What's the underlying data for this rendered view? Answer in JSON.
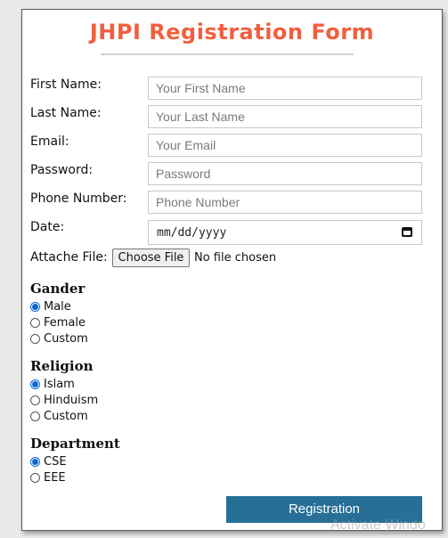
{
  "form": {
    "title": "JHPI Registration Form",
    "accent_color": "#f15f3f",
    "fields": {
      "first_name": {
        "label": "First Name:",
        "placeholder": "Your First Name"
      },
      "last_name": {
        "label": "Last Name:",
        "placeholder": "Your Last Name"
      },
      "email": {
        "label": "Email:",
        "placeholder": "Your Email"
      },
      "password": {
        "label": "Password:",
        "placeholder": "Password"
      },
      "phone": {
        "label": "Phone Number:",
        "placeholder": "Phone Number"
      },
      "date": {
        "label": "Date:",
        "value": "mm/dd/yyyy",
        "icon": "calendar-icon"
      },
      "file": {
        "label": "Attache File:",
        "button_label": "Choose File",
        "status": "No file chosen"
      }
    },
    "gender": {
      "heading": "Gander",
      "options": [
        {
          "label": "Male",
          "checked": true
        },
        {
          "label": "Female",
          "checked": false
        },
        {
          "label": "Custom",
          "checked": false
        }
      ]
    },
    "religion": {
      "heading": "Religion",
      "options": [
        {
          "label": "Islam",
          "checked": true
        },
        {
          "label": "Hinduism",
          "checked": false
        },
        {
          "label": "Custom",
          "checked": false
        }
      ]
    },
    "department": {
      "heading": "Department",
      "options": [
        {
          "label": "CSE",
          "checked": true
        },
        {
          "label": "EEE",
          "checked": false
        }
      ]
    },
    "submit": {
      "label": "Registration",
      "color": "#276f97"
    }
  },
  "overlay": {
    "watermark": "Activate Windo"
  }
}
